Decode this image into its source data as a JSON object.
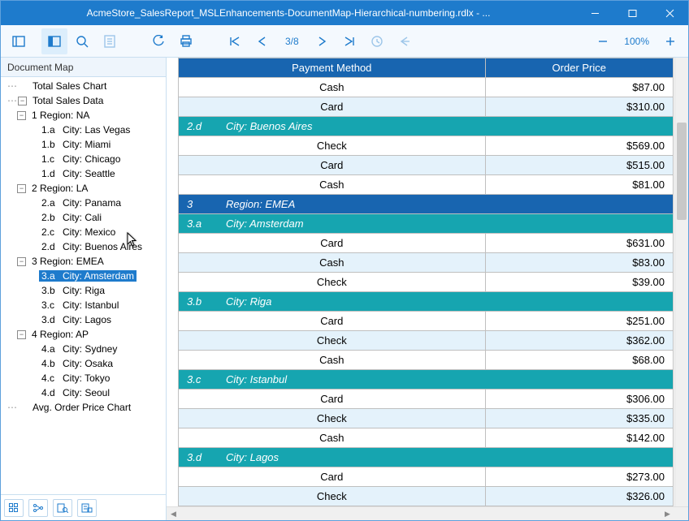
{
  "window": {
    "title": "AcmeStore_SalesReport_MSLEnhancements-DocumentMap-Hierarchical-numbering.rdlx - ..."
  },
  "toolbar": {
    "page_indicator": "3/8",
    "zoom_label": "100%"
  },
  "sidebar": {
    "title": "Document Map",
    "tree": {
      "total_chart": "Total Sales Chart",
      "total_data": "Total Sales Data",
      "avg_chart": "Avg. Order Price Chart",
      "regions": [
        {
          "idx": "1",
          "label": "Region: NA",
          "cities": [
            {
              "idx": "1.a",
              "label": "City: Las Vegas"
            },
            {
              "idx": "1.b",
              "label": "City: Miami"
            },
            {
              "idx": "1.c",
              "label": "City: Chicago"
            },
            {
              "idx": "1.d",
              "label": "City: Seattle"
            }
          ]
        },
        {
          "idx": "2",
          "label": "Region: LA",
          "cities": [
            {
              "idx": "2.a",
              "label": "City: Panama"
            },
            {
              "idx": "2.b",
              "label": "City: Cali"
            },
            {
              "idx": "2.c",
              "label": "City: Mexico"
            },
            {
              "idx": "2.d",
              "label": "City: Buenos Aires"
            }
          ]
        },
        {
          "idx": "3",
          "label": "Region: EMEA",
          "cities": [
            {
              "idx": "3.a",
              "label": "City: Amsterdam"
            },
            {
              "idx": "3.b",
              "label": "City: Riga"
            },
            {
              "idx": "3.c",
              "label": "City: Istanbul"
            },
            {
              "idx": "3.d",
              "label": "City: Lagos"
            }
          ]
        },
        {
          "idx": "4",
          "label": "Region: AP",
          "cities": [
            {
              "idx": "4.a",
              "label": "City: Sydney"
            },
            {
              "idx": "4.b",
              "label": "City: Osaka"
            },
            {
              "idx": "4.c",
              "label": "City: Tokyo"
            },
            {
              "idx": "4.d",
              "label": "City: Seoul"
            }
          ]
        }
      ]
    }
  },
  "report": {
    "headers": {
      "col1": "Payment Method",
      "col2": "Order Price"
    },
    "rows": [
      {
        "type": "data",
        "c1": "Cash",
        "c2": "$87.00"
      },
      {
        "type": "data",
        "c1": "Card",
        "c2": "$310.00"
      },
      {
        "type": "city",
        "idx": "2.d",
        "label": "City: Buenos Aires"
      },
      {
        "type": "data",
        "c1": "Check",
        "c2": "$569.00"
      },
      {
        "type": "data",
        "c1": "Card",
        "c2": "$515.00"
      },
      {
        "type": "data",
        "c1": "Cash",
        "c2": "$81.00"
      },
      {
        "type": "region",
        "idx": "3",
        "label": "Region: EMEA"
      },
      {
        "type": "city",
        "idx": "3.a",
        "label": "City: Amsterdam"
      },
      {
        "type": "data",
        "c1": "Card",
        "c2": "$631.00"
      },
      {
        "type": "data",
        "c1": "Cash",
        "c2": "$83.00"
      },
      {
        "type": "data",
        "c1": "Check",
        "c2": "$39.00"
      },
      {
        "type": "city",
        "idx": "3.b",
        "label": "City: Riga"
      },
      {
        "type": "data",
        "c1": "Card",
        "c2": "$251.00"
      },
      {
        "type": "data",
        "c1": "Check",
        "c2": "$362.00"
      },
      {
        "type": "data",
        "c1": "Cash",
        "c2": "$68.00"
      },
      {
        "type": "city",
        "idx": "3.c",
        "label": "City: Istanbul"
      },
      {
        "type": "data",
        "c1": "Card",
        "c2": "$306.00"
      },
      {
        "type": "data",
        "c1": "Check",
        "c2": "$335.00"
      },
      {
        "type": "data",
        "c1": "Cash",
        "c2": "$142.00"
      },
      {
        "type": "city",
        "idx": "3.d",
        "label": "City: Lagos"
      },
      {
        "type": "data",
        "c1": "Card",
        "c2": "$273.00"
      },
      {
        "type": "data",
        "c1": "Check",
        "c2": "$326.00"
      }
    ]
  }
}
